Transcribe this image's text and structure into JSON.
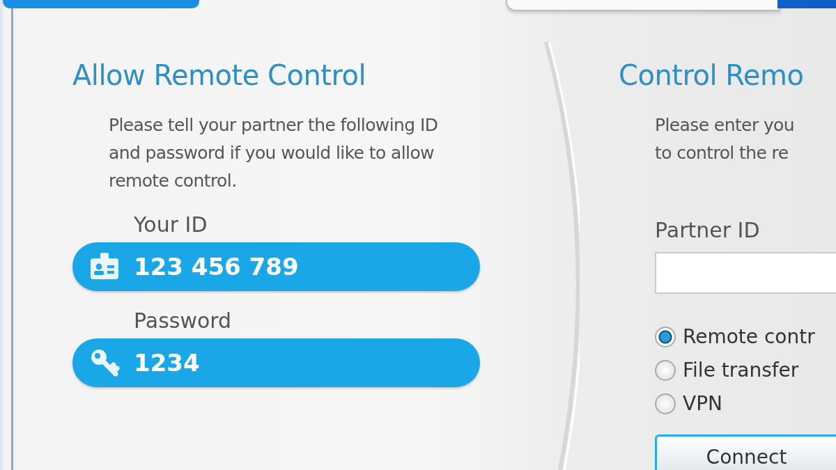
{
  "allow": {
    "title": "Allow Remote Control",
    "text": "Please tell your partner the following ID and password if you would like to allow remote control.",
    "fields": [
      {
        "kind": "id",
        "label": "Your ID",
        "value": "123 456 789"
      },
      {
        "kind": "password",
        "label": "Password",
        "value": "1234"
      }
    ]
  },
  "control": {
    "title": "Control Remo",
    "text_lines": [
      "Please enter you",
      "to control the re"
    ],
    "partner_label": "Partner ID",
    "modes": [
      {
        "label": "Remote contr",
        "selected": true
      },
      {
        "label": "File transfer",
        "selected": false
      },
      {
        "label": "VPN",
        "selected": false
      }
    ],
    "connect_button": "Connect"
  }
}
